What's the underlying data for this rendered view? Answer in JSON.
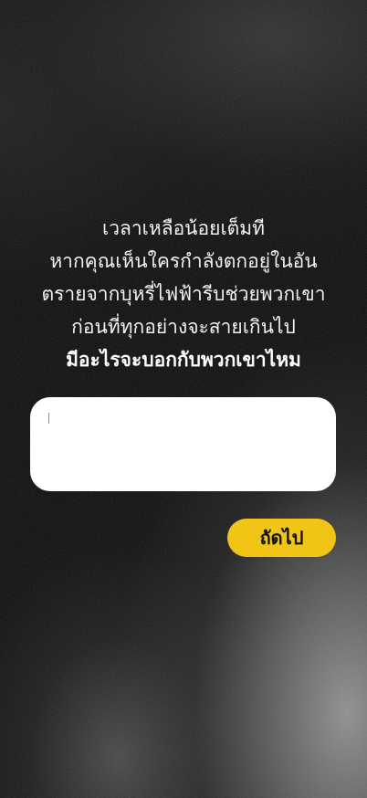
{
  "prompt": {
    "lines": [
      "เวลาเหลือน้อยเต็มที",
      "หากคุณเห็นใครกำลังตกอยู่ในอัน",
      "ตรายจากบุหรี่ไฟฟ้ารีบช่วยพวกเขา",
      "ก่อนที่ทุกอย่างจะสายเกินไป"
    ],
    "question": "มีอะไรจะบอกกับพวกเขาไหม"
  },
  "answer": {
    "value": "",
    "placeholder": ""
  },
  "next_button": {
    "label": "ถัดไป"
  },
  "colors": {
    "background": "#0b0b0b",
    "text": "#f2f2f2",
    "input_background": "#ffffff",
    "button_background": "#f2c415",
    "button_text": "#111111"
  }
}
